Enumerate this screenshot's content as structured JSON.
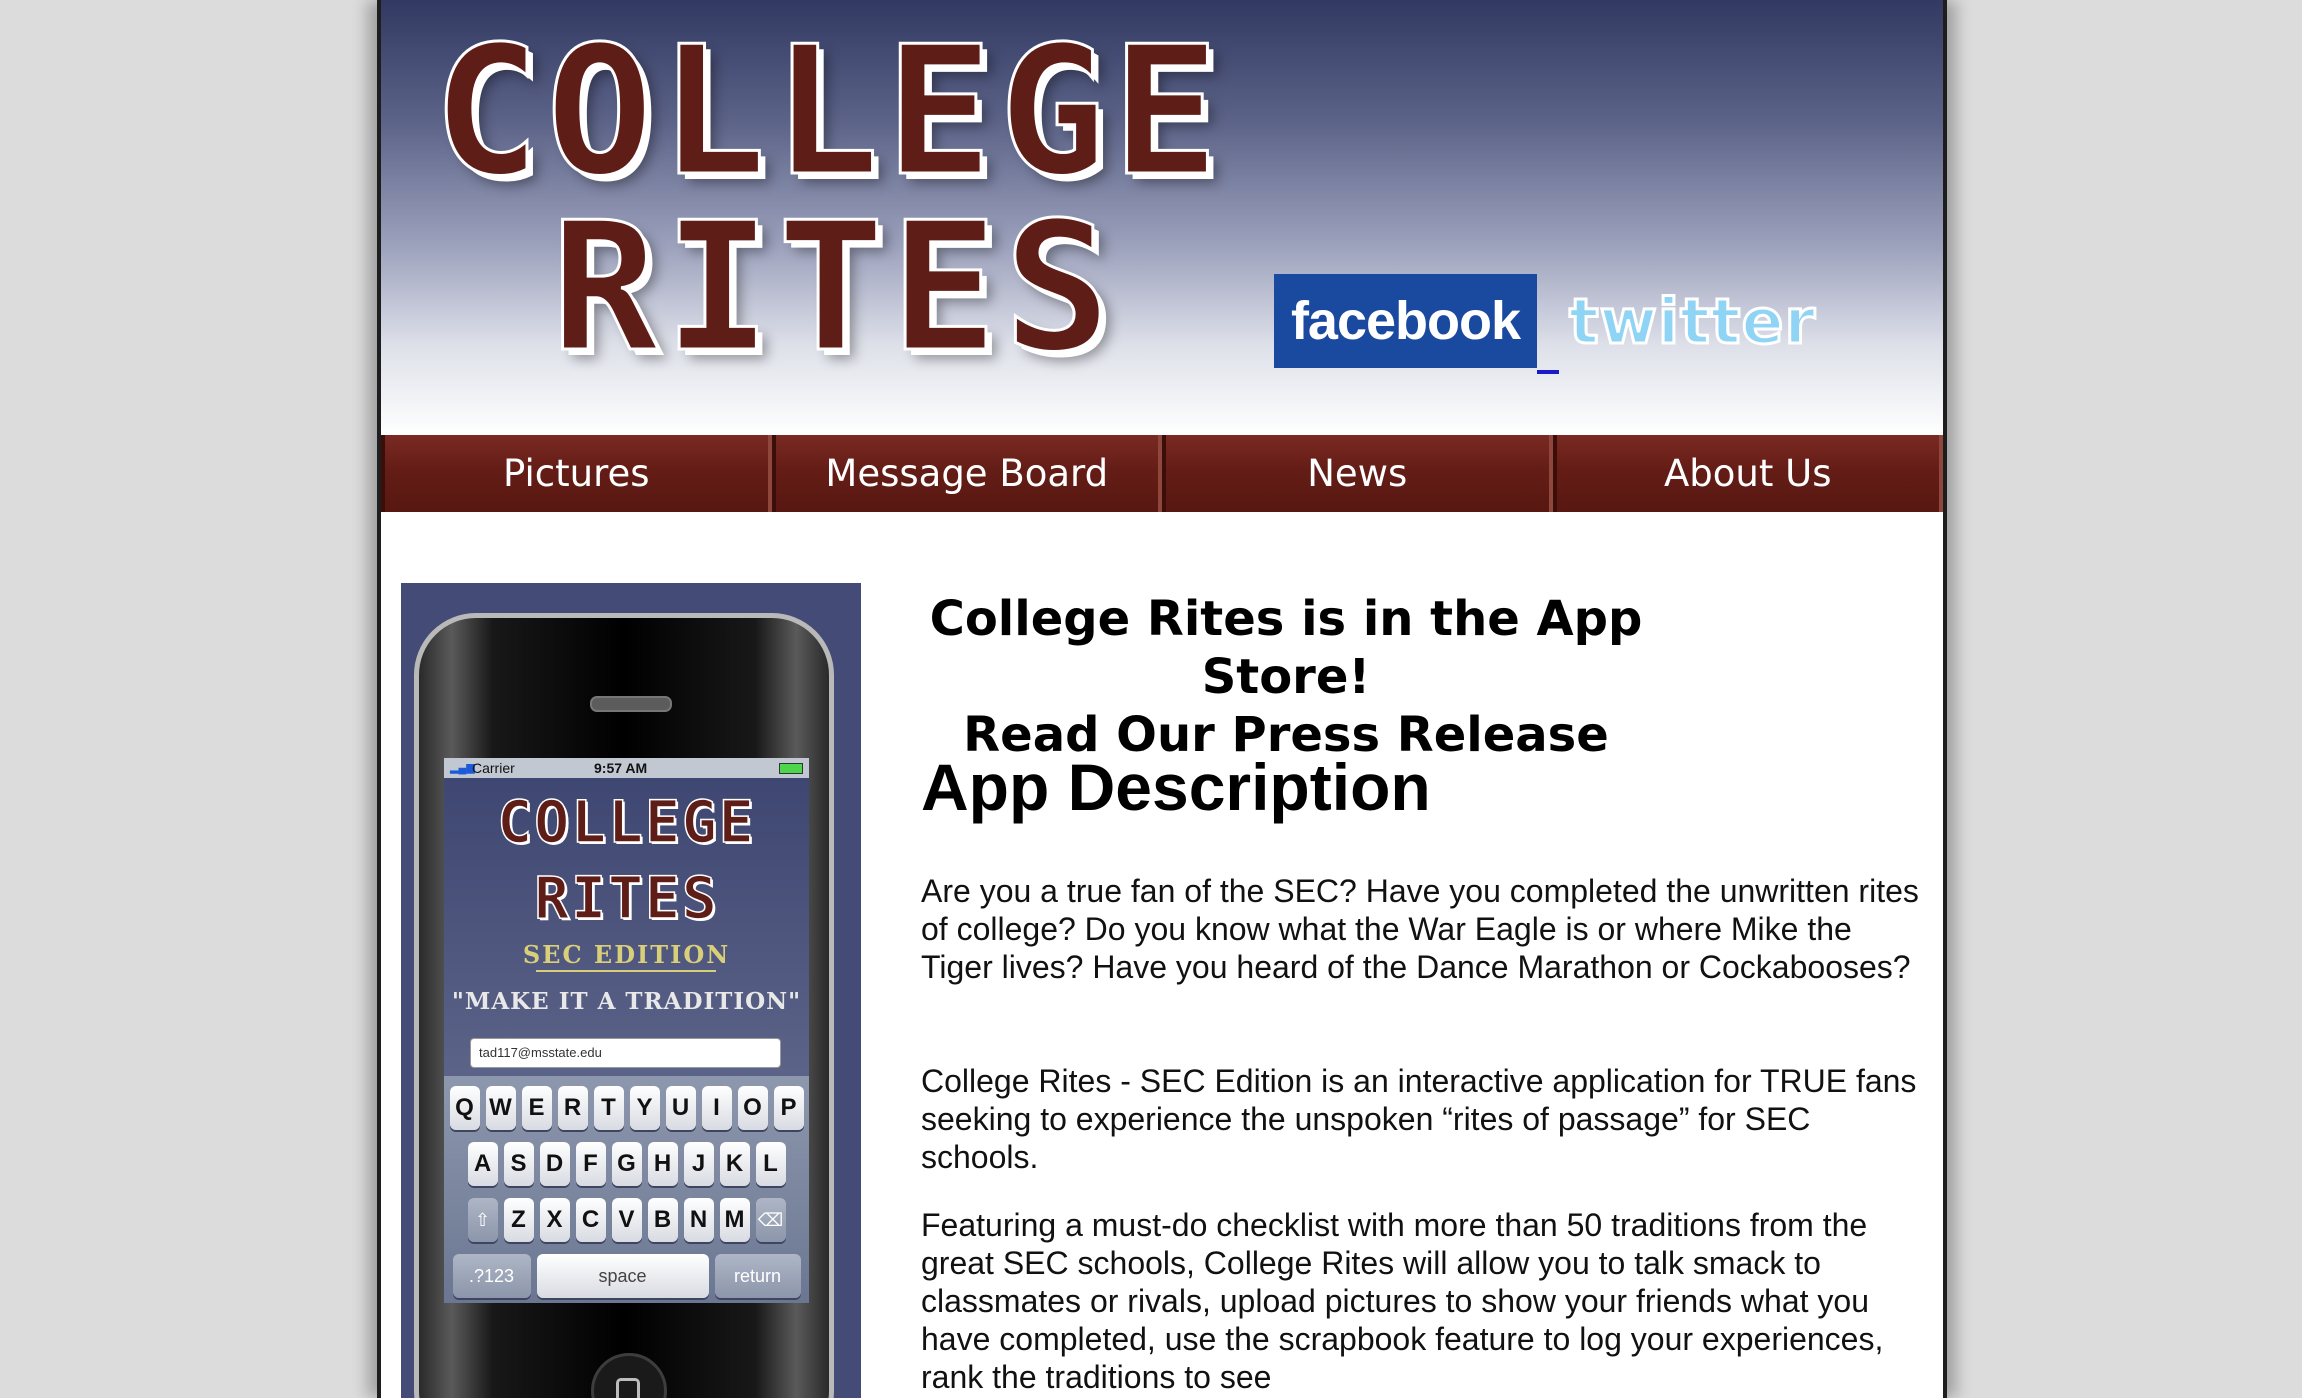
{
  "header": {
    "logo_line_1": "COLLEGE",
    "logo_line_2": "RITES",
    "facebook_label": "facebook",
    "twitter_label": "twitter"
  },
  "nav": {
    "items": [
      {
        "label": "Pictures"
      },
      {
        "label": "Message Board"
      },
      {
        "label": "News"
      },
      {
        "label": "About Us"
      }
    ]
  },
  "phone": {
    "status_carrier": "Carrier",
    "status_time": "9:57 AM",
    "app_logo_1": "COLLEGE",
    "app_logo_2": "RITES",
    "edition": "SEC EDITION",
    "tagline": "\"MAKE IT A TRADITION\"",
    "email_value": "tad117@msstate.edu",
    "keyboard_rows": [
      [
        "Q",
        "W",
        "E",
        "R",
        "T",
        "Y",
        "U",
        "I",
        "O",
        "P"
      ],
      [
        "A",
        "S",
        "D",
        "F",
        "G",
        "H",
        "J",
        "K",
        "L"
      ],
      [
        "Z",
        "X",
        "C",
        "V",
        "B",
        "N",
        "M"
      ]
    ],
    "key_numbers": ".?123",
    "key_space": "space",
    "key_return": "return"
  },
  "content": {
    "headline_line_1": "College Rites is in the App Store!",
    "headline_line_2": "Read Our Press Release",
    "description_heading": "App Description",
    "paragraph_1": "Are you a true fan of the SEC? Have you completed the unwritten rites of college? Do you know what the War Eagle is or where Mike the Tiger lives? Have you heard of the Dance Marathon or Cockabooses?",
    "paragraph_2": "College Rites - SEC Edition is an interactive application for TRUE fans seeking to experience the unspoken “rites of passage” for SEC schools.",
    "paragraph_3": "Featuring a must-do checklist with more than 50 traditions from the great SEC schools, College Rites will allow you to talk smack to classmates or rivals, upload pictures to show your friends what you have completed, use the scrapbook feature to log your experiences, rank the traditions to see"
  },
  "colors": {
    "brand_maroon": "#5e1d17",
    "header_navy": "#323962",
    "facebook_blue": "#1a4aa0",
    "twitter_blue": "#8fd3f5"
  }
}
